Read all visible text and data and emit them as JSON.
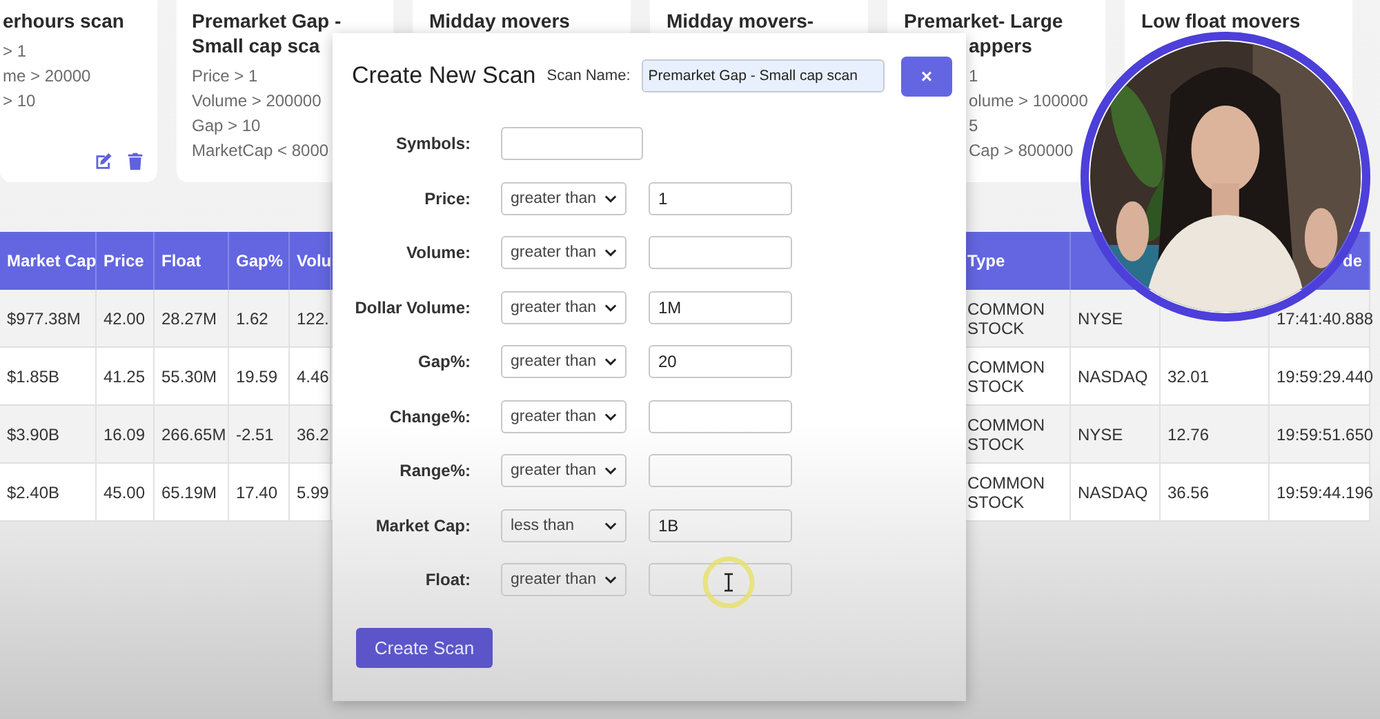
{
  "scan_cards": [
    {
      "kind": "actions",
      "title_lines": [
        "erhours scan"
      ],
      "rules": [
        "> 1",
        "me > 20000",
        "> 10"
      ]
    },
    {
      "kind": "plain",
      "title_lines": [
        "Premarket Gap -",
        "Small cap sca"
      ],
      "rules": [
        "Price > 1",
        "Volume > 200000",
        "Gap > 10",
        "MarketCap < 8000"
      ]
    },
    {
      "kind": "plain",
      "title_lines": [
        "Midday movers"
      ]
    },
    {
      "kind": "plain",
      "title_lines": [
        "Midday movers-"
      ]
    },
    {
      "kind": "behind-dialog",
      "title_lines": [
        "Premarket- Large",
        "appers"
      ],
      "rules": [
        "1",
        "olume > 100000",
        "5",
        "Cap > 800000"
      ]
    },
    {
      "kind": "plain",
      "title_lines": [
        "Low float movers"
      ]
    }
  ],
  "table": {
    "columns": [
      {
        "label": "Market Cap"
      },
      {
        "label": "Price"
      },
      {
        "label": "Float"
      },
      {
        "label": "Gap%"
      },
      {
        "label": "Volu"
      },
      {
        "label": "Type"
      },
      {},
      {},
      {
        "label": "de"
      }
    ],
    "rows": [
      [
        "$977.38M",
        "42.00",
        "28.27M",
        "1.62",
        "122.",
        "COMMON STOCK",
        "NYSE",
        null,
        "17:41:40.888"
      ],
      [
        "$1.85B",
        "41.25",
        "55.30M",
        "19.59",
        "4.46",
        "COMMON STOCK",
        "NASDAQ",
        "32.01",
        "19:59:29.440"
      ],
      [
        "$3.90B",
        "16.09",
        "266.65M",
        "-2.51",
        "36.2",
        "COMMON STOCK",
        "NYSE",
        "12.76",
        "19:59:51.650"
      ],
      [
        "$2.40B",
        "45.00",
        "65.19M",
        "17.40",
        "5.99",
        "COMMON STOCK",
        "NASDAQ",
        "36.56",
        "19:59:44.196"
      ]
    ]
  },
  "dialog": {
    "title": "Create New Scan",
    "scan_name_label": "Scan Name:",
    "scan_name": "Premarket Gap - Small cap scan",
    "close": "×",
    "fields": [
      {
        "kind": "text",
        "label": "Symbols:"
      },
      {
        "kind": "compare",
        "label": "Price:",
        "operator": "greater than",
        "value": "1"
      },
      {
        "kind": "compare",
        "label": "Volume:",
        "operator": "greater than"
      },
      {
        "kind": "compare",
        "label": "Dollar Volume:",
        "operator": "greater than",
        "value": "1M"
      },
      {
        "kind": "compare",
        "label": "Gap%:",
        "operator": "greater than",
        "value": "20"
      },
      {
        "kind": "compare",
        "label": "Change%:",
        "operator": "greater than"
      },
      {
        "kind": "compare",
        "label": "Range%:",
        "operator": "greater than"
      },
      {
        "kind": "compare",
        "label": "Market Cap:",
        "operator": "less than",
        "value": "1B"
      },
      {
        "kind": "compare",
        "label": "Float:",
        "operator": "greater than"
      }
    ],
    "submit": "Create Scan"
  }
}
